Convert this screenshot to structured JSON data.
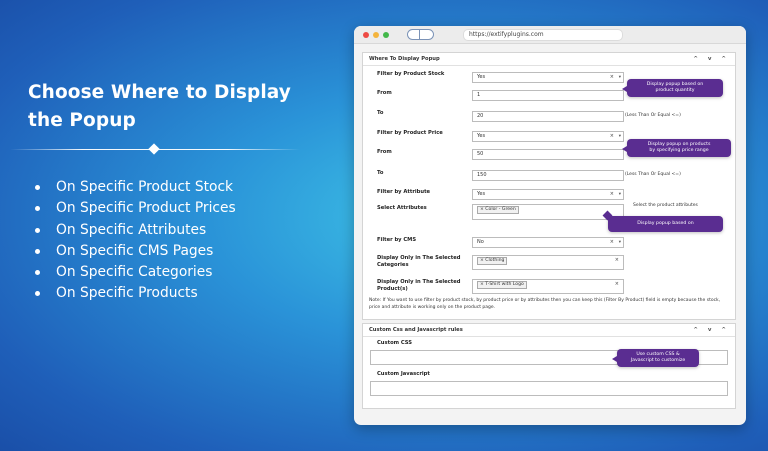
{
  "left": {
    "headline": "Choose Where to Display the Popup",
    "features": [
      "On Specific Product Stock",
      "On Specific Product Prices",
      "On Specific Attributes",
      "On Specific CMS Pages",
      "On Specific Categories",
      "On Specific Products"
    ]
  },
  "browser": {
    "url": "https://extifyplugins.com"
  },
  "display_panel": {
    "title": "Where To Display Popup",
    "controls": "^ v ^",
    "filter_stock_label": "Filter by Product Stock",
    "filter_stock_value": "Yes",
    "from_label": "From",
    "from_value": "1",
    "to_label": "To",
    "to_value": "20",
    "to_hint": "(Less Than Or Equal <=)",
    "filter_price_label": "Filter by Product Price",
    "filter_price_value": "Yes",
    "price_from_label": "From",
    "price_from_value": "50",
    "price_to_label": "To",
    "price_to_value": "150",
    "price_to_hint": "(Less Than Or Equal <=)",
    "filter_attr_label": "Filter by Attribute",
    "filter_attr_value": "Yes",
    "select_attr_label": "Select Attributes",
    "select_attr_tag": "× Color - Green",
    "select_attr_hint": "Select the product attributes",
    "filter_cms_label": "Filter by CMS",
    "filter_cms_value": "No",
    "categories_label_1": "Display Only in The Selected",
    "categories_label_2": "Categories",
    "categories_tag": "× Clothing",
    "products_label_1": "Display Only in The Selected",
    "products_label_2": "Product(s)",
    "products_tag": "× T-Shirt with Logo",
    "clear": "×",
    "dropdown": "▾",
    "note": "Note: If You want to use filter by product stock, by product price or by attributes then you can keep this (Filter By Product) field is empty because the stock, price and attribute is working only on the product page."
  },
  "tooltips": {
    "stock_1": "Display popup based on",
    "stock_2": "product quantity",
    "price_1": "Display popup on products",
    "price_2": "by specifying price range",
    "attr": "Display popup based on",
    "css_1": "Use custom CSS &",
    "css_2": "Javascript to customize"
  },
  "custom_panel": {
    "title": "Custom Css and Javascript rules",
    "controls": "^ v ^",
    "css_label": "Custom CSS",
    "js_label": "Custom Javascript"
  }
}
